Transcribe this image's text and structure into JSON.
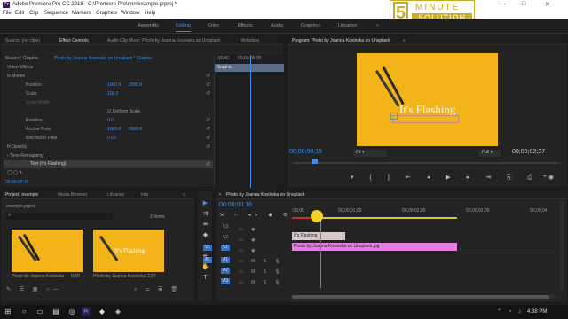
{
  "app": {
    "title": "Adobe Premiere Pro CC 2018 - C:\\Premiere Pro\\nnn\\example.prproj *",
    "icon": "Pr"
  },
  "window_controls": {
    "minimize": "—",
    "maximize": "□",
    "close": "✕"
  },
  "menu": [
    "File",
    "Edit",
    "Clip",
    "Sequence",
    "Markers",
    "Graphics",
    "Window",
    "Help"
  ],
  "workspaces": [
    "Assembly",
    "Editing",
    "Color",
    "Effects",
    "Audio",
    "Graphics",
    "Libraries"
  ],
  "active_workspace": "Editing",
  "logo": {
    "number": "5",
    "line1": "MINUTE",
    "line2": "SOLUTION"
  },
  "source_panel": {
    "tabs": [
      "Source: (no clips)",
      "Effect Controls",
      "Audio Clip Mixer: Photo by Joanna Kosinska on Unsplash",
      "Metadata"
    ],
    "active_tab": "Effect Controls",
    "master_label": "Master * Graphic",
    "clip_label": "Photo by Joanna Kosinska on Unsplash * Graphic",
    "section": "Video Effects",
    "motion": "Motion",
    "properties": [
      {
        "name": "Position",
        "v1": "1000.0",
        "v2": "2000.0"
      },
      {
        "name": "Scale",
        "v1": "100.0",
        "v2": ""
      },
      {
        "name": "Scale Width",
        "v1": "",
        "v2": ""
      },
      {
        "name": "Uniform Scale",
        "v1": "",
        "v2": ""
      },
      {
        "name": "Rotation",
        "v1": "0.0",
        "v2": ""
      },
      {
        "name": "Anchor Point",
        "v1": "1000.0",
        "v2": "2000.0"
      },
      {
        "name": "Anti-flicker Filter",
        "v1": "0.00",
        "v2": ""
      }
    ],
    "opacity": "Opacity",
    "time_remapping": "Time Remapping",
    "text_layer": "Text (It's Flashing)",
    "timecode": "00;00;00;16",
    "graphic_clip": "Graphic",
    "ruler": [
      ":00;00",
      "00;00;05;00",
      "00;00"
    ]
  },
  "program_panel": {
    "title": "Program: Photo by Joanna Kosinska on Unsplash",
    "overlay_text": "It's Flashing",
    "timecode": "00;00;00;16",
    "fit": "Fit",
    "quality": "Full",
    "duration": "00;00;02;27"
  },
  "project_panel": {
    "tabs": [
      "Project: example",
      "Media Browser",
      "Libraries",
      "Info"
    ],
    "filename": "example.prproj",
    "item_count": "2 Items",
    "items": [
      {
        "name": "Photo by Joanna Kosinska",
        "duration": "0;29"
      },
      {
        "name": "Photo by Joanna Kosinska",
        "duration": "2;27"
      }
    ]
  },
  "timeline": {
    "title": "Photo by Joanna Kosinska on Unsplash",
    "timecode": "00;00;00;16",
    "ruler": [
      ":00;00",
      "00;00;01;00",
      "00;00;02;00",
      "00;00;03;00",
      "00;00;04"
    ],
    "tracks": [
      "V3",
      "V2",
      "V1",
      "A1",
      "A2",
      "A3"
    ],
    "target_v": "V1",
    "target_a": "A1",
    "clips": [
      {
        "track": "V2",
        "name": "It's Flashing",
        "color": "#d6c9c9"
      },
      {
        "track": "V1",
        "name": "Photo by Joanna Kosinska on Unsplash.jpg",
        "color": "#e27ee1"
      }
    ]
  },
  "taskbar": {
    "time": "4:38 PM"
  },
  "colors": {
    "accent": "#3d8ee6",
    "playhead": "#3d8ee6",
    "yellow": "#f2b418"
  }
}
